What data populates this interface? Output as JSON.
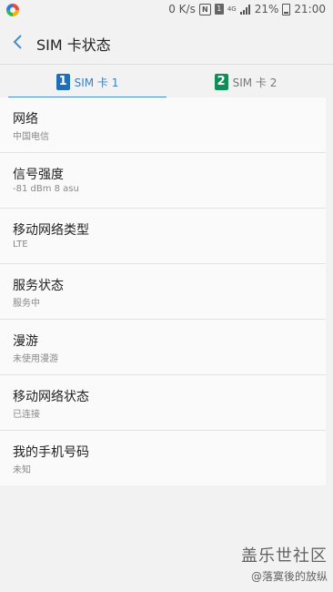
{
  "status_bar": {
    "speed": "0 K/s",
    "net_type": "4G",
    "battery": "21%",
    "time": "21:00"
  },
  "header": {
    "title": "SIM 卡状态",
    "back_icon": "chevron-left-icon"
  },
  "tabs": [
    {
      "badge": "1",
      "label": "SIM 卡 1",
      "selected": true,
      "color": "#1c6fb8"
    },
    {
      "badge": "2",
      "label": "SIM 卡 2",
      "selected": false,
      "color": "#0f8f57"
    }
  ],
  "items": [
    {
      "title": "网络",
      "value": "中国电信"
    },
    {
      "title": "信号强度",
      "value": "-81 dBm 8 asu"
    },
    {
      "title": "移动网络类型",
      "value": "LTE"
    },
    {
      "title": "服务状态",
      "value": "服务中"
    },
    {
      "title": "漫游",
      "value": "未使用漫游"
    },
    {
      "title": "移动网络状态",
      "value": "已连接"
    },
    {
      "title": "我的手机号码",
      "value": "未知"
    }
  ],
  "watermark": {
    "title": "盖乐世社区",
    "user": "@落寞後的放纵"
  },
  "colors": {
    "accent": "#3e7fb9",
    "background": "#f2f2f2"
  }
}
